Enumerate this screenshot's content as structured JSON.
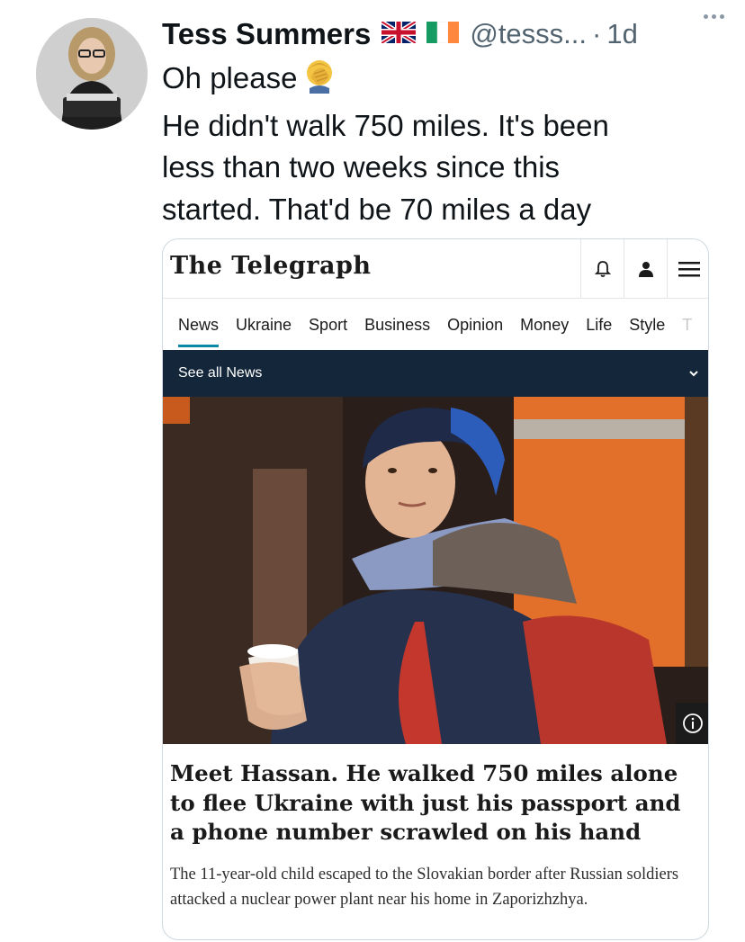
{
  "tweet": {
    "author": {
      "display_name": "Tess Summers",
      "flags": [
        "uk-flag",
        "ireland-flag"
      ],
      "handle": "@tesss...",
      "separator": "·",
      "timestamp": "1d"
    },
    "text_lines": [
      "Oh please",
      "He didn't walk 750 miles. It's been",
      "less than two weeks since this",
      "started. That'd be 70 miles a day"
    ],
    "emoji": "face-palm-emoji"
  },
  "card": {
    "brand": "The Telegraph",
    "header_icons": [
      "bell-icon",
      "user-icon",
      "hamburger-menu-icon"
    ],
    "nav": {
      "items": [
        "News",
        "Ukraine",
        "Sport",
        "Business",
        "Opinion",
        "Money",
        "Life",
        "Style",
        "T"
      ],
      "active": "News"
    },
    "section_bar": {
      "label": "See all News"
    },
    "headline": "Meet Hassan. He walked 750 miles alone to flee Ukraine with just his passport and a phone number scrawled on his hand",
    "standfirst": "The 11-year-old child escaped to the Slovakian border after Russian soldiers attacked a nuclear power plant near his home in Zaporizhzhya."
  },
  "colors": {
    "text_primary": "#0f1419",
    "text_secondary": "#536471",
    "card_border": "#cfd9de",
    "telegraph_bar": "#13263a",
    "nav_underline": "#0a8aa6"
  }
}
